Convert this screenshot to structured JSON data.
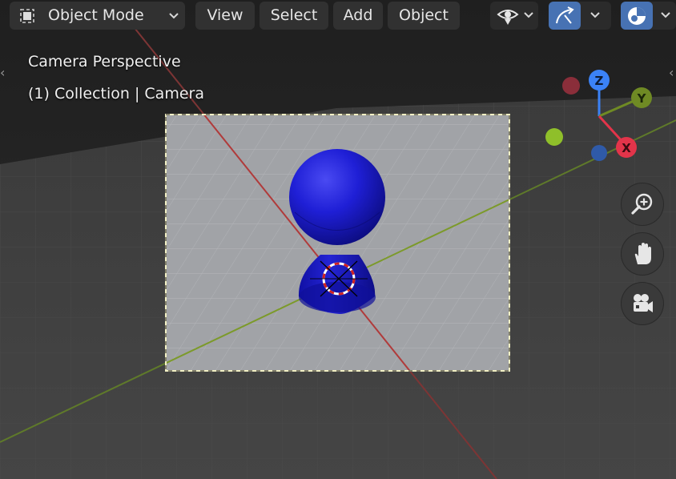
{
  "header": {
    "mode": {
      "label": "Object Mode",
      "icon": "object-mode-icon"
    },
    "menus": [
      "View",
      "Select",
      "Add",
      "Object"
    ],
    "icons": [
      "visibility-eye-icon",
      "gizmo-icon",
      "viewport-shading-icon",
      "chevron-down-icon"
    ]
  },
  "viewport": {
    "view_name": "Camera Perspective",
    "collection_info": "(1) Collection | Camera"
  },
  "gizmo": {
    "axes": [
      {
        "label": "Z",
        "color": "#3b82f6"
      },
      {
        "label": "Y",
        "color": "#6f8a24"
      },
      {
        "label": "X",
        "color": "#e2344a"
      }
    ]
  },
  "nav_buttons": [
    {
      "name": "zoom-button",
      "icon": "zoom-in-icon"
    },
    {
      "name": "pan-button",
      "icon": "hand-icon"
    },
    {
      "name": "camera-view-button",
      "icon": "camera-icon"
    }
  ],
  "colors": {
    "background": "#222222",
    "floor_outside": "#3d3d3d",
    "floor_camera": "#a2a4a8",
    "x_axis": "#c84a4a",
    "y_axis": "#7a9a2f",
    "camera_frame": "#f2f0c4",
    "object_blue": "#1c1ccc"
  }
}
